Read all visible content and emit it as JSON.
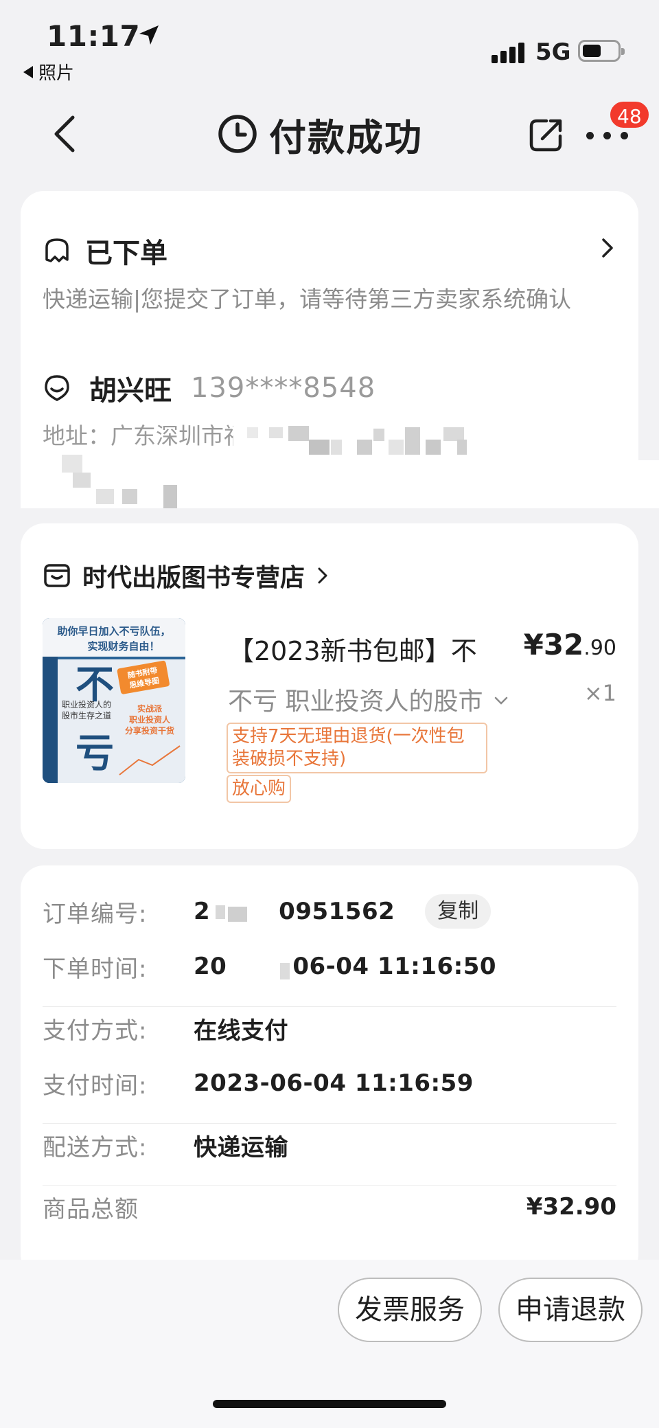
{
  "status_bar": {
    "time": "11:17",
    "back_app": "照片",
    "network": "5G"
  },
  "nav": {
    "title": "付款成功",
    "badge_count": "48"
  },
  "order": {
    "status": "已下单",
    "description": "快递运输|您提交了订单，请等待第三方卖家系统确认",
    "recipient_name": "胡兴旺",
    "recipient_phone": "139****8548",
    "address": "地址：广东深圳市福田区"
  },
  "store": {
    "name": "时代出版图书专营店"
  },
  "product": {
    "title": "【2023新书包邮】不",
    "subtitle": "不亏 职业投资人的股市",
    "price_currency": "¥",
    "price_int": "32",
    "price_dec": ".90",
    "quantity": "×1",
    "tag_return": "支持7天无理由退货(一次性包装破损不支持)",
    "tag_assure": "放心购",
    "cover": {
      "banner": "助你早日加入不亏队伍，实现财务自由！",
      "big_char_1": "不",
      "big_char_2": "亏",
      "subtitle": "职业投资人的股市生存之道",
      "sticker": "随书附带思维导图",
      "slogan": "实战派职业投资人分享投资干货"
    }
  },
  "info": {
    "order_no_label": "订单编号:",
    "order_no_value": "2",
    "order_no_value_tail": "0951562",
    "copy_label": "复制",
    "order_time_label": "下单时间:",
    "order_time_value": "20",
    "order_time_value_tail": "06-04 11:16:50",
    "pay_method_label": "支付方式:",
    "pay_method_value": "在线支付",
    "pay_time_label": "支付时间:",
    "pay_time_value": "2023-06-04 11:16:59",
    "delivery_label": "配送方式:",
    "delivery_value": "快递运输",
    "total_label": "商品总额",
    "total_value": "¥32.90"
  },
  "actions": {
    "invoice": "发票服务",
    "refund": "申请退款"
  },
  "colors": {
    "accent_orange": "#e8763a",
    "badge_red": "#f23a2c",
    "cover_blue": "#2b6496"
  }
}
